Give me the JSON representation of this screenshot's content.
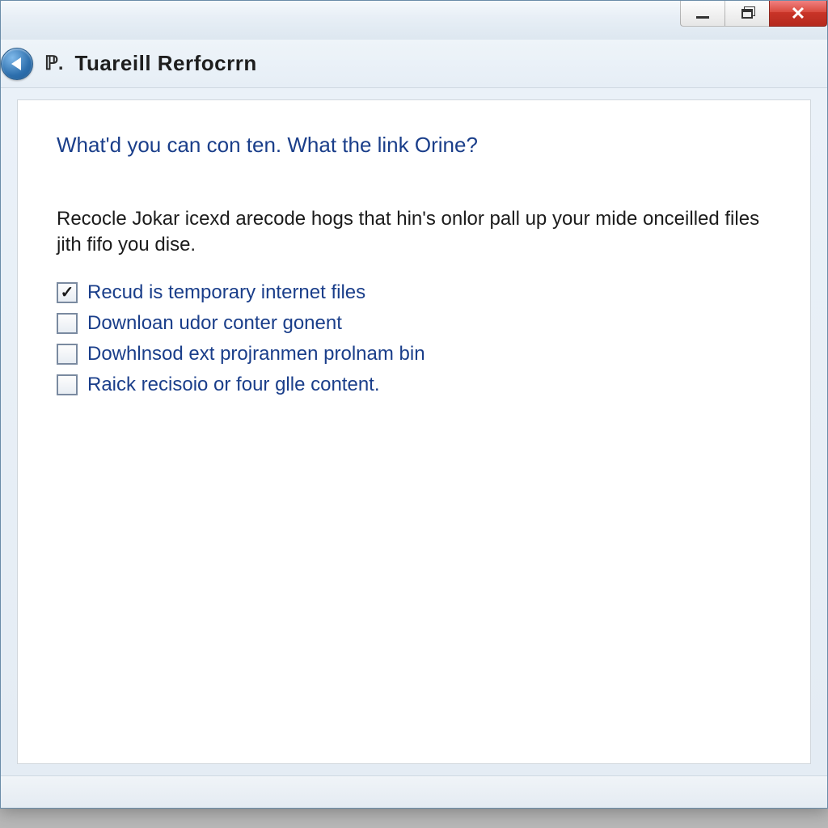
{
  "window": {
    "title": "Tuareill Rerfocrrn"
  },
  "wizard": {
    "heading": "What'd you can con ten. What the link Orine?",
    "description": "Recocle Jokar icexd arecode hogs that hin's onlor pall up your mide onceilled files jith fifo you dise.",
    "options": [
      {
        "label": "Recud is temporary internet files",
        "checked": true
      },
      {
        "label": "Downloan udor conter gonent",
        "checked": false
      },
      {
        "label": "Dowhlnsod ext projranmen prolnam bin",
        "checked": false
      },
      {
        "label": "Raick recisoio or four glle content.",
        "checked": false
      }
    ]
  }
}
